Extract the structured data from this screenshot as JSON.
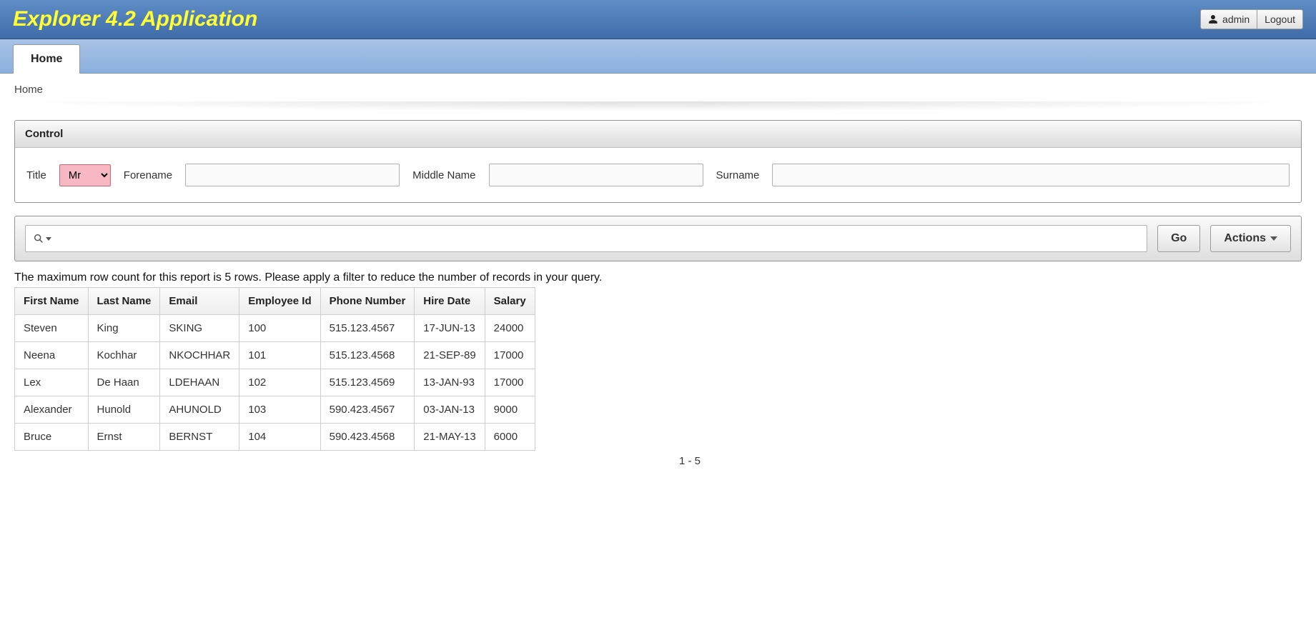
{
  "header": {
    "app_title": "Explorer 4.2 Application",
    "user_label": "admin",
    "logout_label": "Logout"
  },
  "tabs": {
    "home": "Home"
  },
  "breadcrumb": {
    "home": "Home"
  },
  "control_panel": {
    "title": "Control",
    "fields": {
      "title_label": "Title",
      "title_value": "Mr",
      "forename_label": "Forename",
      "forename_value": "",
      "middlename_label": "Middle Name",
      "middlename_value": "",
      "surname_label": "Surname",
      "surname_value": ""
    }
  },
  "search_bar": {
    "go_label": "Go",
    "actions_label": "Actions",
    "search_value": ""
  },
  "report": {
    "message": "The maximum row count for this report is 5 rows. Please apply a filter to reduce the number of records in your query.",
    "columns": {
      "first_name": "First Name",
      "last_name": "Last Name",
      "email": "Email",
      "employee_id": "Employee Id",
      "phone": "Phone Number",
      "hire_date": "Hire Date",
      "salary": "Salary"
    },
    "rows": [
      {
        "first_name": "Steven",
        "last_name": "King",
        "email": "SKING",
        "employee_id": "100",
        "phone": "515.123.4567",
        "hire_date": "17-JUN-13",
        "salary": "24000"
      },
      {
        "first_name": "Neena",
        "last_name": "Kochhar",
        "email": "NKOCHHAR",
        "employee_id": "101",
        "phone": "515.123.4568",
        "hire_date": "21-SEP-89",
        "salary": "17000"
      },
      {
        "first_name": "Lex",
        "last_name": "De Haan",
        "email": "LDEHAAN",
        "employee_id": "102",
        "phone": "515.123.4569",
        "hire_date": "13-JAN-93",
        "salary": "17000"
      },
      {
        "first_name": "Alexander",
        "last_name": "Hunold",
        "email": "AHUNOLD",
        "employee_id": "103",
        "phone": "590.423.4567",
        "hire_date": "03-JAN-13",
        "salary": "9000"
      },
      {
        "first_name": "Bruce",
        "last_name": "Ernst",
        "email": "BERNST",
        "employee_id": "104",
        "phone": "590.423.4568",
        "hire_date": "21-MAY-13",
        "salary": "6000"
      }
    ],
    "pager": "1 - 5"
  }
}
